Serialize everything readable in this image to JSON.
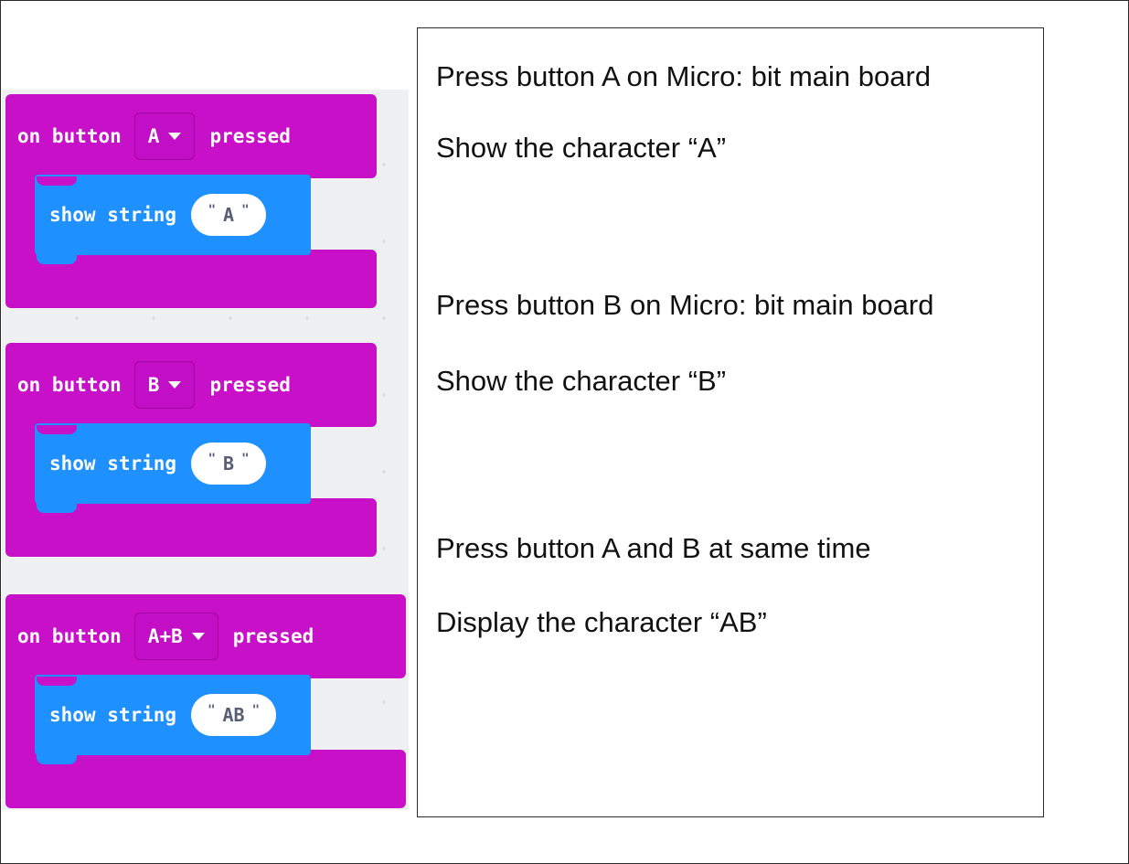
{
  "blocks": [
    {
      "prefix": "on button",
      "button": "A",
      "suffix": "pressed",
      "statement": "show string",
      "value": "A"
    },
    {
      "prefix": "on button",
      "button": "B",
      "suffix": "pressed",
      "statement": "show string",
      "value": "B"
    },
    {
      "prefix": "on button",
      "button": "A+B",
      "suffix": "pressed",
      "statement": "show string",
      "value": "AB"
    }
  ],
  "descriptions": [
    "Press button A on Micro: bit main board",
    "Show the character “A”",
    "Press button B on Micro: bit main board",
    "Show the character “B”",
    "Press button A and B at same time",
    "Display the character “AB”"
  ],
  "colors": {
    "event_block": "#c710c7",
    "basic_block": "#1e90ff",
    "workspace": "#eef0f2"
  },
  "icons": {
    "dropdown": "caret-down-icon"
  }
}
